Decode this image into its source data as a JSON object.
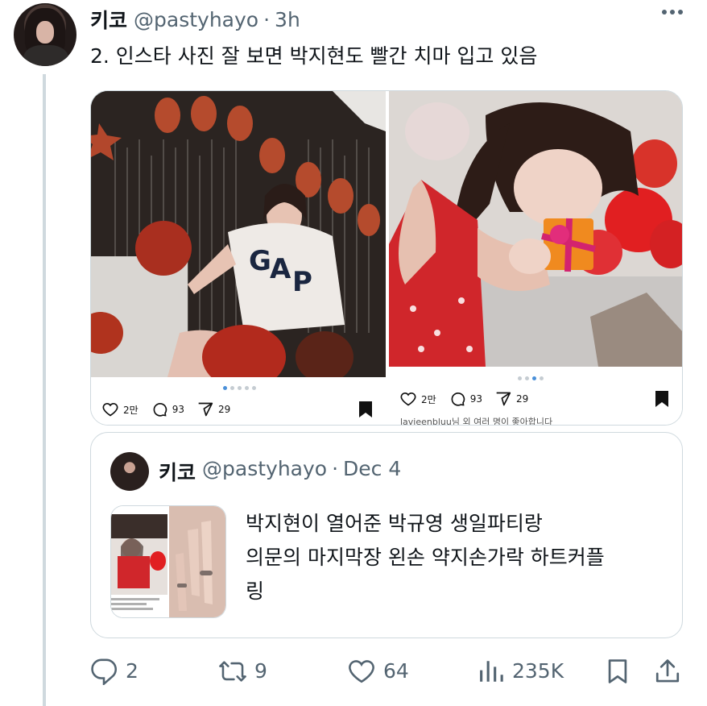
{
  "tweet": {
    "author_name": "키코",
    "author_handle": "@pastyhayo",
    "separator": "·",
    "time": "3h",
    "text": "2. 인스타 사진 잘 보면 박지현도 빨간 치마 입고 있음"
  },
  "media": {
    "left": {
      "like_count": "2만",
      "comment_count": "93",
      "share_count": "29"
    },
    "right": {
      "like_count": "2만",
      "comment_count": "93",
      "share_count": "29",
      "caption": "lavieenbluu님 외 여러 명이 좋아합니다"
    }
  },
  "quote": {
    "author_name": "키코",
    "author_handle": "@pastyhayo",
    "separator": "·",
    "date": "Dec 4",
    "lines": [
      "박지현이 열어준 박규영 생일파티랑",
      "의문의 마지막장 왼손 약지손가락 하트커플",
      "링"
    ]
  },
  "actions": {
    "replies": "2",
    "retweets": "9",
    "likes": "64",
    "views": "235K"
  },
  "icons": [
    "more-icon",
    "reply-icon",
    "retweet-icon",
    "like-icon",
    "views-icon",
    "bookmark-icon",
    "share-icon"
  ],
  "colors": {
    "text": "#0f1419",
    "muted": "#536471",
    "border": "#cfd9de"
  }
}
